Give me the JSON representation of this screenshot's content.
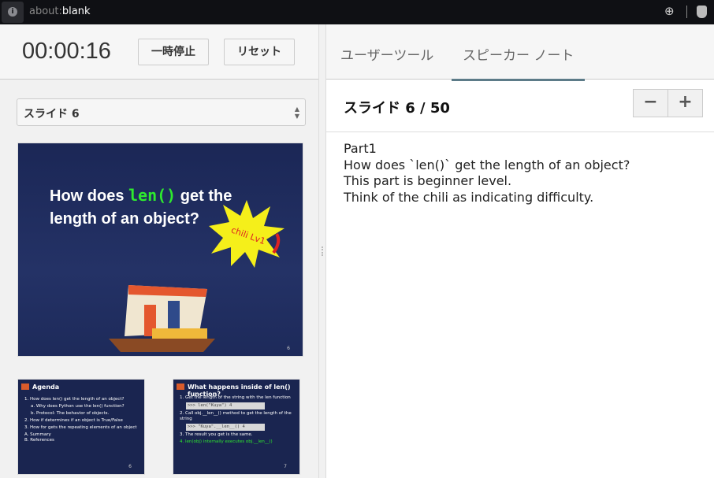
{
  "browser": {
    "url_prefix": "about:",
    "url_main": "blank"
  },
  "timer": {
    "value": "00:00:16",
    "pause_label": "一時停止",
    "reset_label": "リセット"
  },
  "slide_select": {
    "value": "スライド 6"
  },
  "main_slide": {
    "title_1": "How does ",
    "title_code": "len()",
    "title_2": " get the",
    "title_3": "length of an object?",
    "badge": "chili Lv1",
    "page": "6"
  },
  "thumbnails": [
    {
      "title": "Agenda",
      "lines": [
        "1. How does len() get the length of an object?",
        "a. Why does Python use the len() function?",
        "b. Protocol: The behavior of objects.",
        "2. How if determines if an object is True/False",
        "3. How for gets the repeating elements of an object",
        "A. Summary",
        "B. References"
      ],
      "page": "6"
    },
    {
      "title": "What happens inside of len() function?",
      "lines": [
        "1. Get the length of the string with the len function",
        ">>> len(\"Kuya\")\n4",
        "2. Call obj.__len__() method to get the length of the string",
        ">>> \"Kuya\".__len__()\n4",
        "3. The result you get is the same.",
        "4. len(obj) internally executes obj.__len__()"
      ],
      "page": "7"
    }
  ],
  "tabs": [
    {
      "label": "ユーザーツール"
    },
    {
      "label": "スピーカー ノート"
    }
  ],
  "notes": {
    "slide_label": "スライド 6 / 50",
    "lines": [
      "Part1",
      "How does `len()` get the length of an object?",
      "This part is beginner level.",
      "Think of the chili as indicating difficulty."
    ]
  },
  "colors": {
    "accent": "#5c7b88",
    "topbar": "#0f1014",
    "slide_bg": "#1b2756",
    "code_green": "#2eea2e"
  }
}
